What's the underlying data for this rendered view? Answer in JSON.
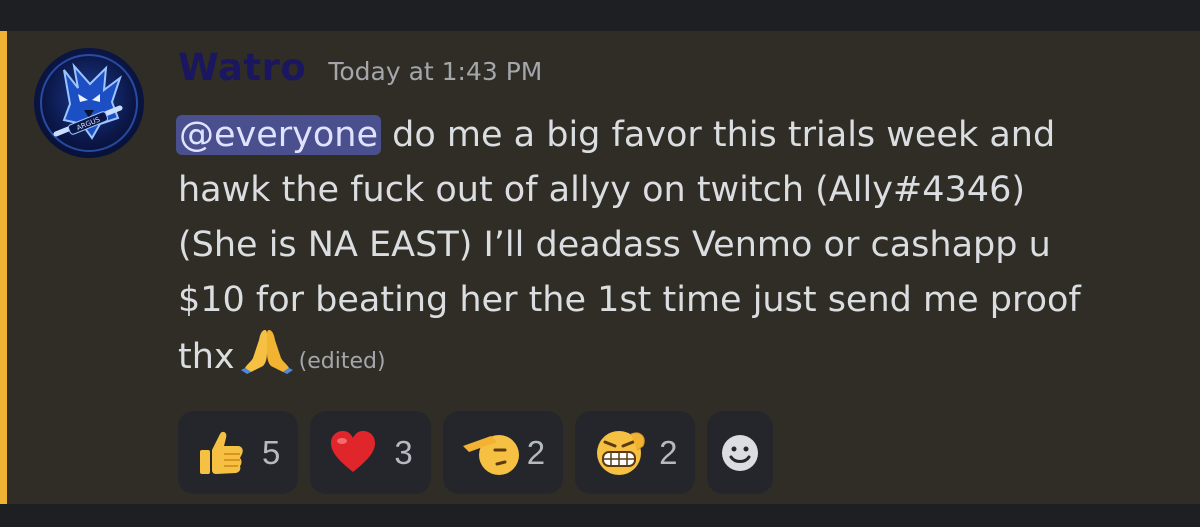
{
  "message": {
    "author": "Watro",
    "timestamp": "Today at 1:43 PM",
    "mention": "@everyone",
    "lines": [
      " do me a big favor this trials week and",
      "hawk the fuck out of allyy on twitch (Ally#4346)",
      "(She is NA EAST) I’ll deadass Venmo or cashapp u",
      "$10 for beating her the 1st time just send me proof",
      "thx"
    ],
    "edited_label": "(edited)",
    "avatar_icon": "wolf-logo-icon",
    "avatar_text": "ARGUS"
  },
  "reactions": [
    {
      "icon": "thumbs-up-icon",
      "count": "5"
    },
    {
      "icon": "red-heart-icon",
      "count": "3"
    },
    {
      "icon": "saluting-face-icon",
      "count": "2"
    },
    {
      "icon": "grimacing-face-icon",
      "count": "2"
    }
  ],
  "add_reaction_icon": "smiley-add-reaction-icon",
  "colors": {
    "accent_bar": "#f0b232",
    "username": "#1a1760",
    "mention_bg": "#4a4f8e",
    "message_bg": "#2f2d26"
  }
}
